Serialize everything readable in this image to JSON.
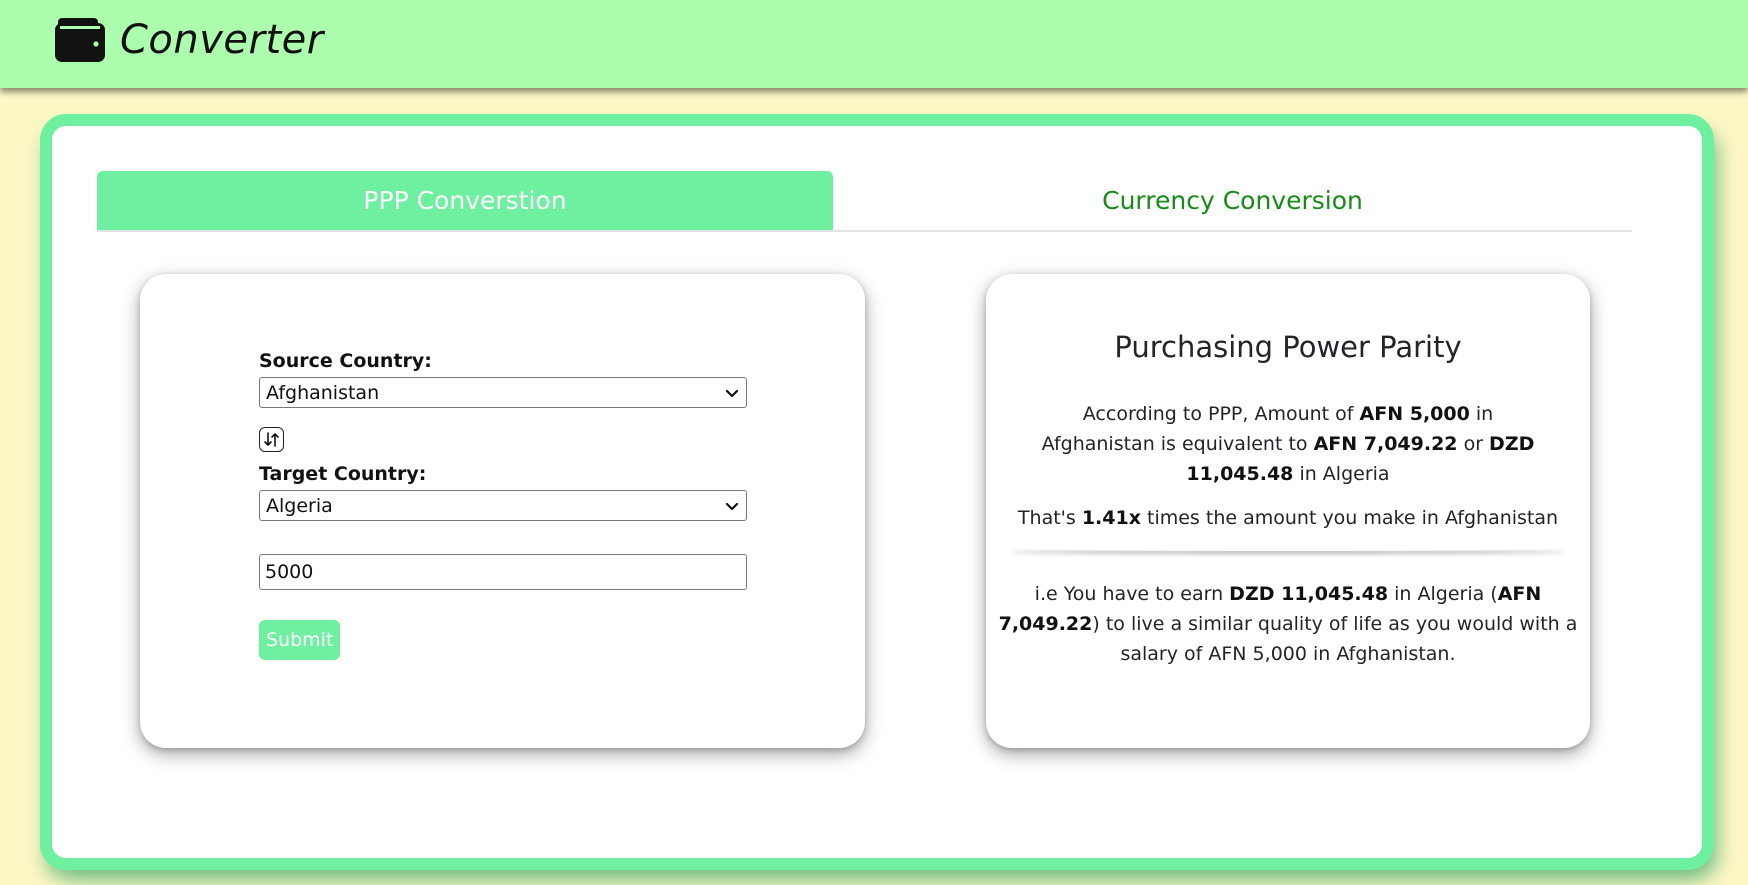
{
  "header": {
    "brand": "Converter",
    "icon": "wallet-icon",
    "background": "#adfdaf"
  },
  "tabs": [
    {
      "label": "PPP Converstion",
      "active": true
    },
    {
      "label": "Currency Conversion",
      "active": false
    }
  ],
  "form": {
    "source_label": "Source Country:",
    "source_value": "Afghanistan",
    "swap_icon": "swap-arrows-icon",
    "target_label": "Target Country:",
    "target_value": "Algeria",
    "amount_value": "5000",
    "submit_label": "Submit"
  },
  "result": {
    "title": "Purchasing Power Parity",
    "p1_a": "According to PPP, Amount of ",
    "p1_b": "AFN 5,000",
    "p1_c": " in Afghanistan is equivalent to ",
    "p1_d": "AFN 7,049.22",
    "p1_e": " or ",
    "p1_f": "DZD 11,045.48",
    "p1_g": " in Algeria",
    "p2_a": "That's ",
    "p2_b": "1.41x",
    "p2_c": " times the amount you make in Afghanistan",
    "p3_a": "i.e You have to earn ",
    "p3_b": "DZD 11,045.48",
    "p3_c": " in Algeria (",
    "p3_d": "AFN 7,049.22",
    "p3_e": ") to live a similar quality of life as you would with a salary of AFN 5,000 in Afghanistan."
  },
  "colors": {
    "accent": "#6ff0a1",
    "page_bg": "#fdf7c6",
    "tab_inactive_text": "#178a17"
  }
}
